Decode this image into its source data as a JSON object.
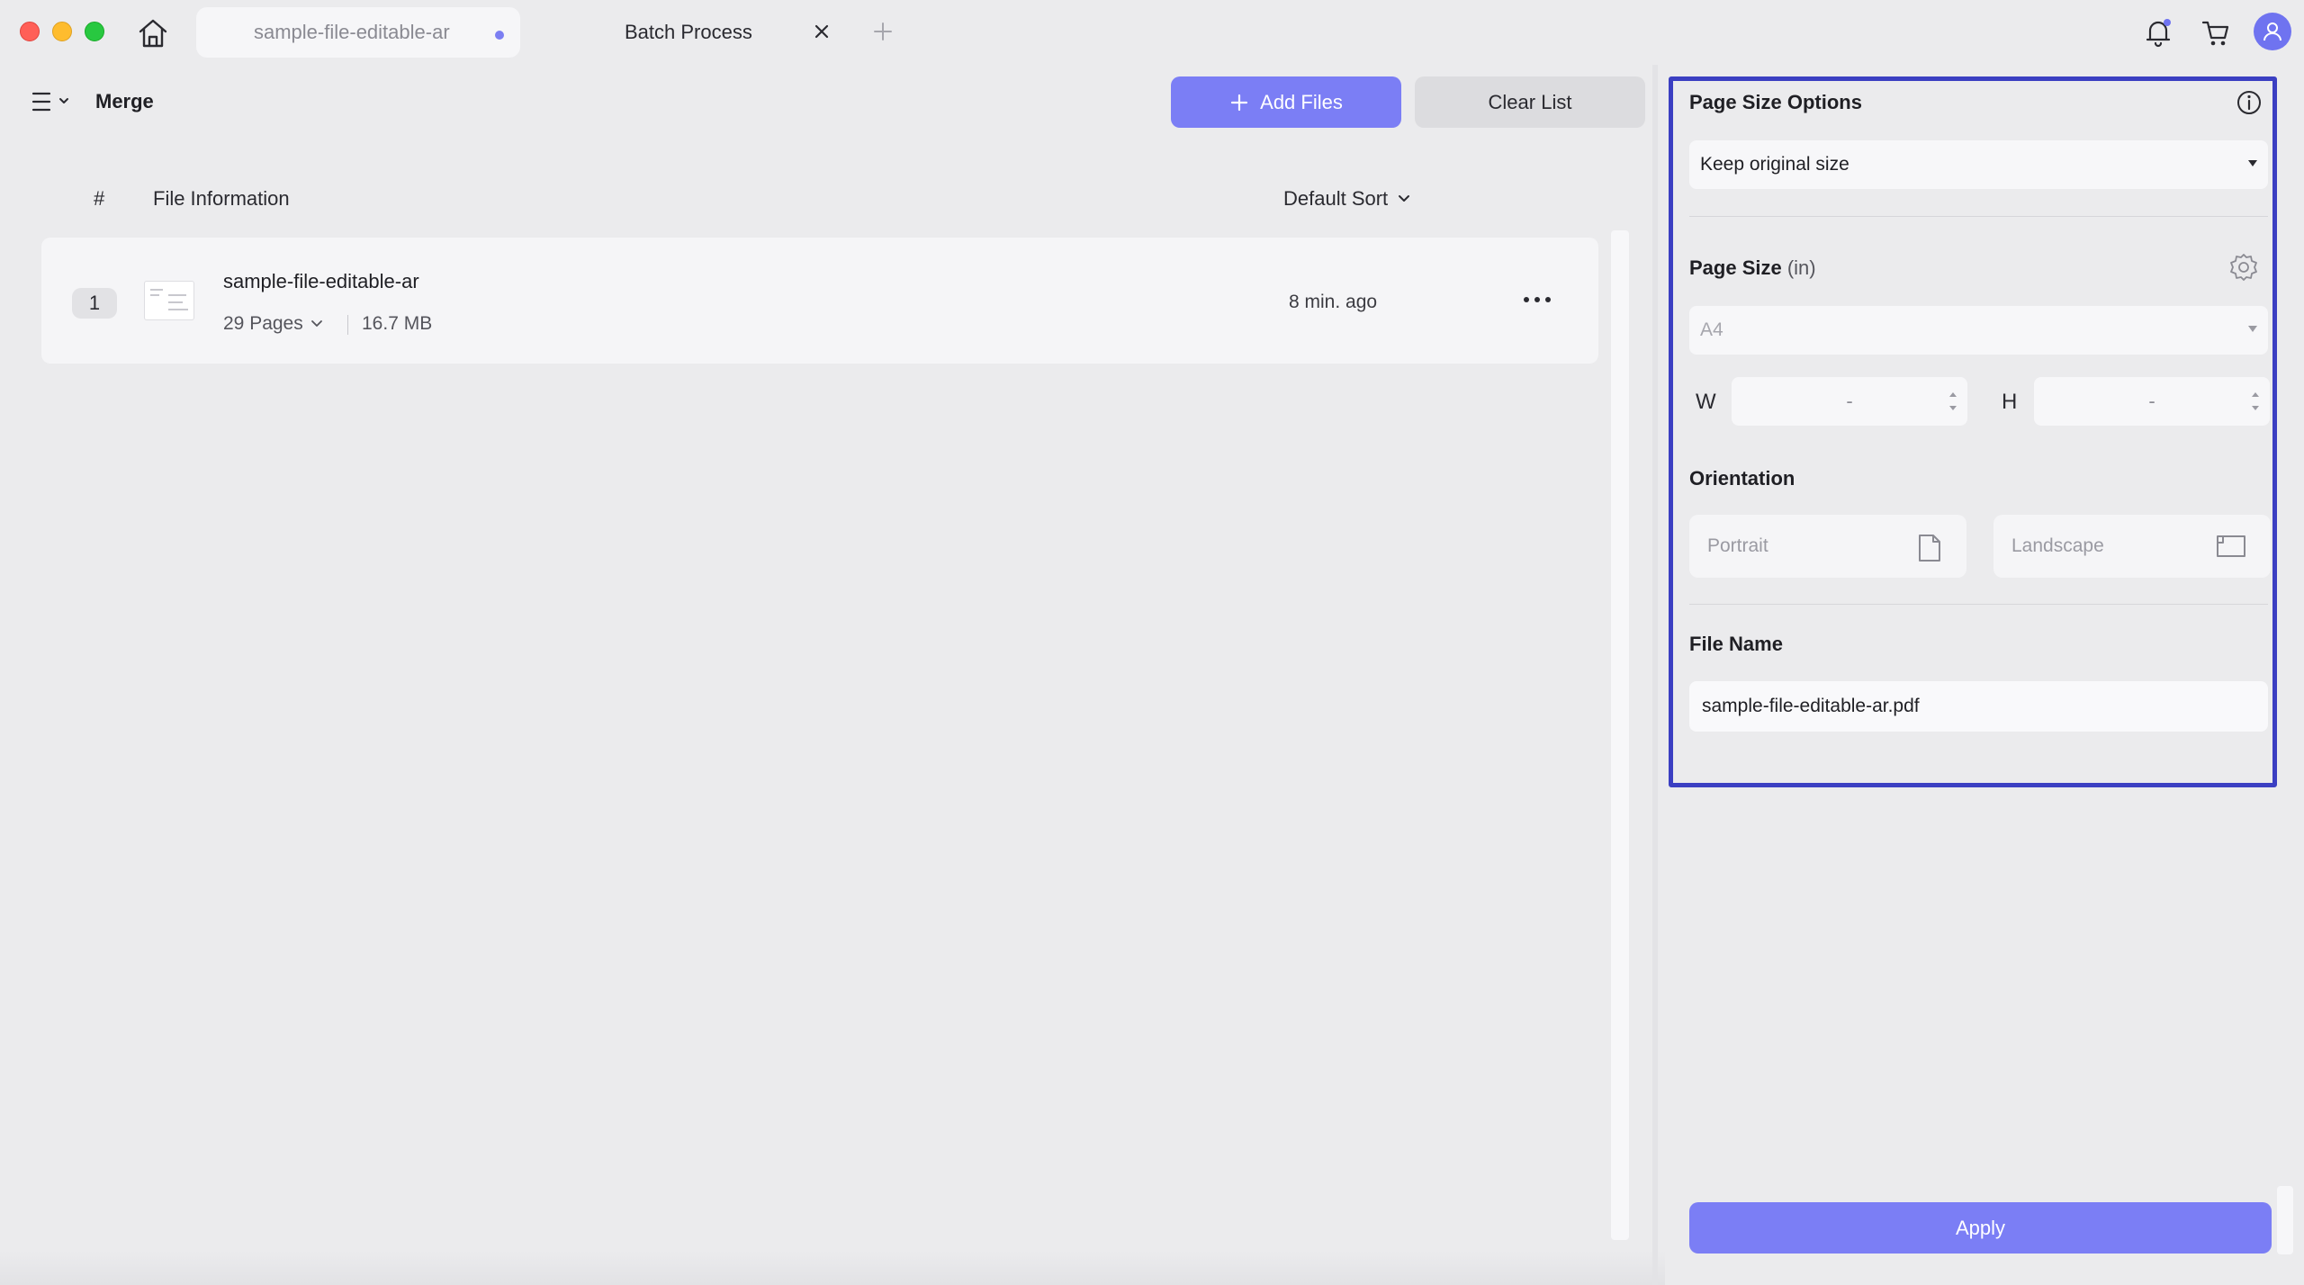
{
  "tabs": [
    {
      "label": "sample-file-editable-ar",
      "modified": true
    },
    {
      "label": "Batch Process"
    }
  ],
  "toolbar": {
    "mode_label": "Merge",
    "add_files_label": "Add Files",
    "clear_list_label": "Clear List"
  },
  "file_list": {
    "columns": {
      "index": "#",
      "info": "File Information",
      "sort": "Default Sort"
    },
    "files": [
      {
        "index": "1",
        "name": "sample-file-editable-ar",
        "pages": "29 Pages",
        "size": "16.7 MB",
        "modified": "8 min. ago"
      }
    ]
  },
  "settings": {
    "page_size_options": {
      "label": "Page Size Options",
      "selected": "Keep original size"
    },
    "page_size": {
      "label": "Page Size",
      "unit": "(in)",
      "selected": "A4",
      "width_label": "W",
      "width_value": "-",
      "height_label": "H",
      "height_value": "-"
    },
    "orientation": {
      "label": "Orientation",
      "options": [
        "Portrait",
        "Landscape"
      ]
    },
    "file_name": {
      "label": "File Name",
      "value": "sample-file-editable-ar.pdf"
    },
    "apply_label": "Apply"
  },
  "colors": {
    "accent": "#7b7ef5",
    "highlight_border": "#3b3fc2",
    "background": "#ebebed"
  },
  "icons": [
    "home-icon",
    "close-icon",
    "plus-icon",
    "bell-icon",
    "cart-icon",
    "user-icon",
    "menu-icon",
    "chevron-down-icon",
    "more-icon",
    "info-icon",
    "gear-icon",
    "portrait-icon",
    "landscape-icon"
  ]
}
